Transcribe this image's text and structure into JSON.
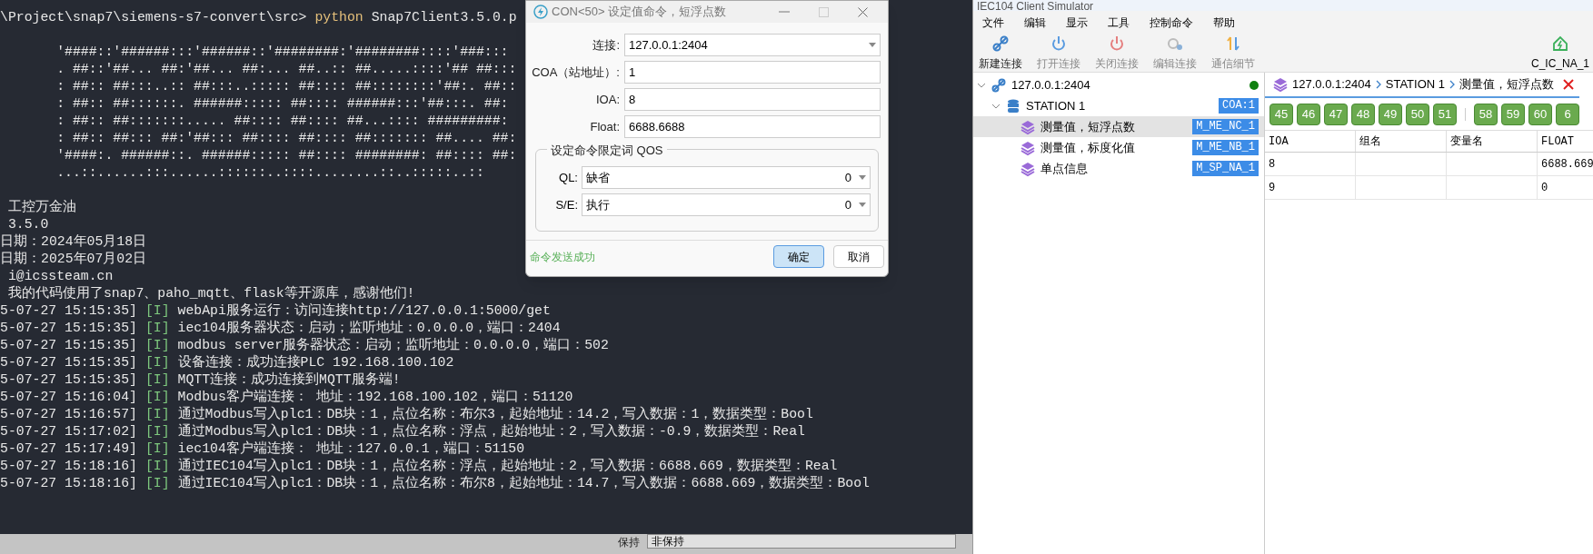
{
  "terminal": {
    "lines": [
      {
        "kind": "prompt",
        "path": "\\Project\\snap7\\siemens-s7-convert\\src>",
        "command": "python",
        "args": "Snap7Client3.5.0.p"
      },
      {
        "kind": "blank"
      },
      {
        "kind": "art",
        "text": "       '####::'######:::'######::'########:'########::::'###:::"
      },
      {
        "kind": "art",
        "text": "       . ##::'##... ##:'##... ##:... ##..:: ##.....::::'## ##:::"
      },
      {
        "kind": "art",
        "text": "       : ##:: ##:::..:: ##:::..::::: ##:::: ##::::::::'##:. ##::"
      },
      {
        "kind": "art",
        "text": "       : ##:: ##::::::. ######::::: ##:::: ######:::'##:::. ##:"
      },
      {
        "kind": "art",
        "text": "       : ##:: ##:::::::..... ##:::: ##:::: ##...:::: #########:"
      },
      {
        "kind": "art",
        "text": "       : ##:: ##::: ##:'##::: ##:::: ##:::: ##::::::: ##.... ##:"
      },
      {
        "kind": "art",
        "text": "       '####:. ######::. ######::::: ##:::: ########: ##:::: ##:"
      },
      {
        "kind": "art",
        "text": "       ...::......:::......::::::..::::........::..:::::..::"
      },
      {
        "kind": "blank"
      },
      {
        "kind": "plain",
        "text": " 工控万金油"
      },
      {
        "kind": "plain",
        "text": " 3.5.0"
      },
      {
        "kind": "plain",
        "text": "日期：2024年05月18日"
      },
      {
        "kind": "plain",
        "text": "日期：2025年07月02日"
      },
      {
        "kind": "plain",
        "text": " i@icssteam.cn"
      },
      {
        "kind": "plain",
        "text": " 我的代码使用了snap7、paho_mqtt、flask等开源库，感谢他们!"
      },
      {
        "kind": "log",
        "time": "5-07-27 15:15:35]",
        "level": "[I]",
        "message": "webApi服务运行：访问连接http://127.0.0.1:5000/get"
      },
      {
        "kind": "log",
        "time": "5-07-27 15:15:35]",
        "level": "[I]",
        "message": "iec104服务器状态：启动；监听地址：0.0.0.0，端口：2404"
      },
      {
        "kind": "log",
        "time": "5-07-27 15:15:35]",
        "level": "[I]",
        "message": "modbus server服务器状态：启动；监听地址：0.0.0.0，端口：502"
      },
      {
        "kind": "log",
        "time": "5-07-27 15:15:35]",
        "level": "[I]",
        "message": "设备连接：成功连接PLC 192.168.100.102"
      },
      {
        "kind": "log",
        "time": "5-07-27 15:15:35]",
        "level": "[I]",
        "message": "MQTT连接：成功连接到MQTT服务端!"
      },
      {
        "kind": "log",
        "time": "5-07-27 15:16:04]",
        "level": "[I]",
        "message": "Modbus客户端连接： 地址：192.168.100.102，端口：51120"
      },
      {
        "kind": "log",
        "time": "5-07-27 15:16:57]",
        "level": "[I]",
        "message": "通过Modbus写入plc1：DB块：1，点位名称：布尔3，起始地址：14.2，写入数据：1，数据类型：Bool"
      },
      {
        "kind": "log",
        "time": "5-07-27 15:17:02]",
        "level": "[I]",
        "message": "通过Modbus写入plc1：DB块：1，点位名称：浮点，起始地址：2，写入数据：-0.9，数据类型：Real"
      },
      {
        "kind": "log",
        "time": "5-07-27 15:17:49]",
        "level": "[I]",
        "message": "iec104客户端连接： 地址：127.0.0.1，端口：51150"
      },
      {
        "kind": "log",
        "time": "5-07-27 15:18:16]",
        "level": "[I]",
        "message": "通过IEC104写入plc1：DB块：1，点位名称：浮点，起始地址：2，写入数据：6688.669，数据类型：Real"
      },
      {
        "kind": "log",
        "time": "5-07-27 15:18:16]",
        "level": "[I]",
        "message": "通过IEC104写入plc1：DB块：1，点位名称：布尔8，起始地址：14.7，写入数据：6688.669，数据类型：Bool"
      }
    ]
  },
  "background_window": {
    "label": "保持",
    "value": "非保持"
  },
  "dialog": {
    "title": "CON<50> 设定值命令，短浮点数",
    "fields": [
      {
        "kind": "dropdown",
        "label": "连接:",
        "value": "127.0.0.1:2404"
      },
      {
        "kind": "text",
        "label": "COA（站地址）:",
        "value": "1"
      },
      {
        "kind": "text",
        "label": "IOA:",
        "value": "8"
      },
      {
        "kind": "text",
        "label": "Float:",
        "value": "6688.6688"
      }
    ],
    "group": {
      "title": "设定命令限定词 QOS",
      "fields": [
        {
          "label": "QL:",
          "value": "缺省",
          "code": "0"
        },
        {
          "label": "S/E:",
          "value": "执行",
          "code": "0"
        }
      ]
    },
    "status": "命令发送成功",
    "buttons": [
      {
        "label": "确定",
        "default": true
      },
      {
        "label": "取消",
        "default": false
      }
    ]
  },
  "app": {
    "title": "IEC104 Client Simulator",
    "menu": [
      "文件",
      "编辑",
      "显示",
      "工具",
      "控制命令",
      "帮助"
    ],
    "toolbar": [
      {
        "kind": "new",
        "label": "新建连接",
        "disabled": false
      },
      {
        "kind": "open",
        "label": "打开连接",
        "disabled": true
      },
      {
        "kind": "close",
        "label": "关闭连接",
        "disabled": true
      },
      {
        "kind": "edit",
        "label": "编辑连接",
        "disabled": true
      },
      {
        "kind": "details",
        "label": "通信细节",
        "disabled": true
      }
    ],
    "toolbar_right": {
      "label": "C_IC_NA_1"
    },
    "tree": [
      {
        "label": "127.0.0.1:2404",
        "kind": "connection",
        "expanded": true,
        "connected": true,
        "children": [
          {
            "label": "STATION 1",
            "kind": "station",
            "expanded": true,
            "badge": "COA:1",
            "children": [
              {
                "label": "测量值，短浮点数",
                "kind": "type",
                "badge": "M_ME_NC_1",
                "selected": true
              },
              {
                "label": "测量值，标度化值",
                "kind": "type",
                "badge": "M_ME_NB_1",
                "selected": false
              },
              {
                "label": "单点信息",
                "kind": "type",
                "badge": "M_SP_NA_1",
                "selected": false
              }
            ]
          }
        ]
      }
    ],
    "tab": {
      "crumbs": [
        "127.0.0.1:2404",
        "STATION 1",
        "测量值，短浮点数"
      ]
    },
    "groups": [
      [
        "45",
        "46",
        "47",
        "48",
        "49",
        "50",
        "51"
      ],
      [
        "58",
        "59",
        "60",
        "6"
      ]
    ],
    "table": {
      "columns": [
        "IOA",
        "组名",
        "变量名",
        "FLOAT"
      ],
      "rows": [
        {
          "ioa": "8",
          "float": "6688.669"
        },
        {
          "ioa": "9",
          "float": "0"
        }
      ]
    }
  }
}
